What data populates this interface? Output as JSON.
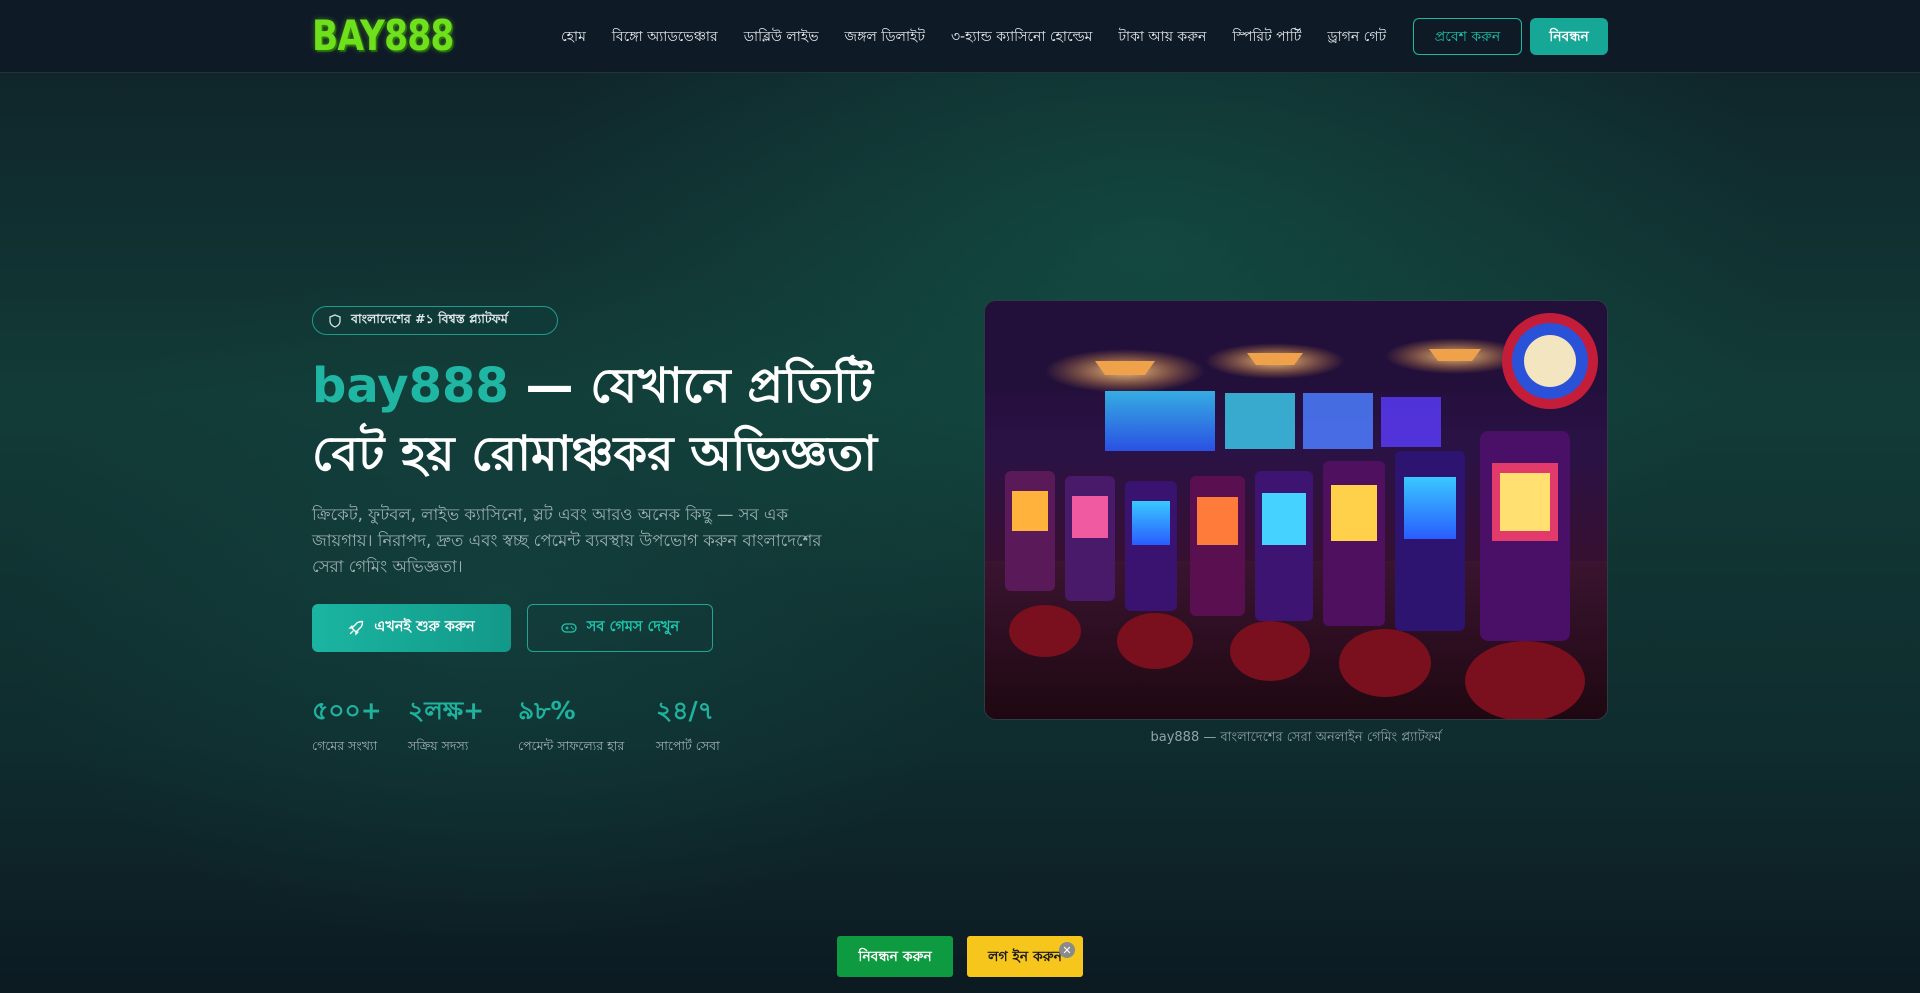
{
  "header": {
    "logo_text": "BAY888",
    "nav": [
      {
        "label": "হোম"
      },
      {
        "label": "বিঙ্গো অ্যাডভেঞ্চার"
      },
      {
        "label": "ডাব্লিউ লাইভ"
      },
      {
        "label": "জঙ্গল ডিলাইট"
      },
      {
        "label": "৩-হ্যান্ড ক্যাসিনো হোল্ডেম"
      },
      {
        "label": "টাকা আয় করুন"
      },
      {
        "label": "স্পিরিট পার্টি"
      },
      {
        "label": "ড্রাগন গেট"
      }
    ],
    "login_label": "প্রবেশ করুন",
    "register_label": "নিবন্ধন"
  },
  "hero": {
    "badge_text": "বাংলাদেশের #১ বিশ্বস্ত প্ল্যাটফর্ম",
    "title_brand": "bay888",
    "title_line1_rest": " — যেখানে প্রতিটি",
    "title_line2": "বেট হয় রোমাঞ্চকর অভিজ্ঞতা",
    "description": "ক্রিকেট, ফুটবল, লাইভ ক্যাসিনো, স্লট এবং আরও অনেক কিছু — সব এক জায়গায়। নিরাপদ, দ্রুত এবং স্বচ্ছ পেমেন্ট ব্যবস্থায় উপভোগ করুন বাংলাদেশের সেরা গেমিং অভিজ্ঞতা।",
    "cta_start_label": "এখনই শুরু করুন",
    "cta_games_label": "সব গেমস দেখুন",
    "stats": [
      {
        "value": "৫০০+",
        "label": "গেমের সংখ্যা"
      },
      {
        "value": "২লক্ষ+",
        "label": "সক্রিয় সদস্য"
      },
      {
        "value": "৯৮%",
        "label": "পেমেন্ট সাফল্যের হার"
      },
      {
        "value": "২৪/৭",
        "label": "সাপোর্ট সেবা"
      }
    ],
    "image_caption": "bay888 — বাংলাদেশের সেরা অনলাইন গেমিং প্ল্যাটফর্ম"
  },
  "bottom_bar": {
    "register_label": "নিবন্ধন করুন",
    "login_label": "লগ ইন করুন",
    "close_symbol": "✕"
  },
  "colors": {
    "accent": "#1fb7a3",
    "logo": "#6ee01c",
    "bottom_register": "#0e9a41",
    "bottom_login": "#f6c61d"
  }
}
